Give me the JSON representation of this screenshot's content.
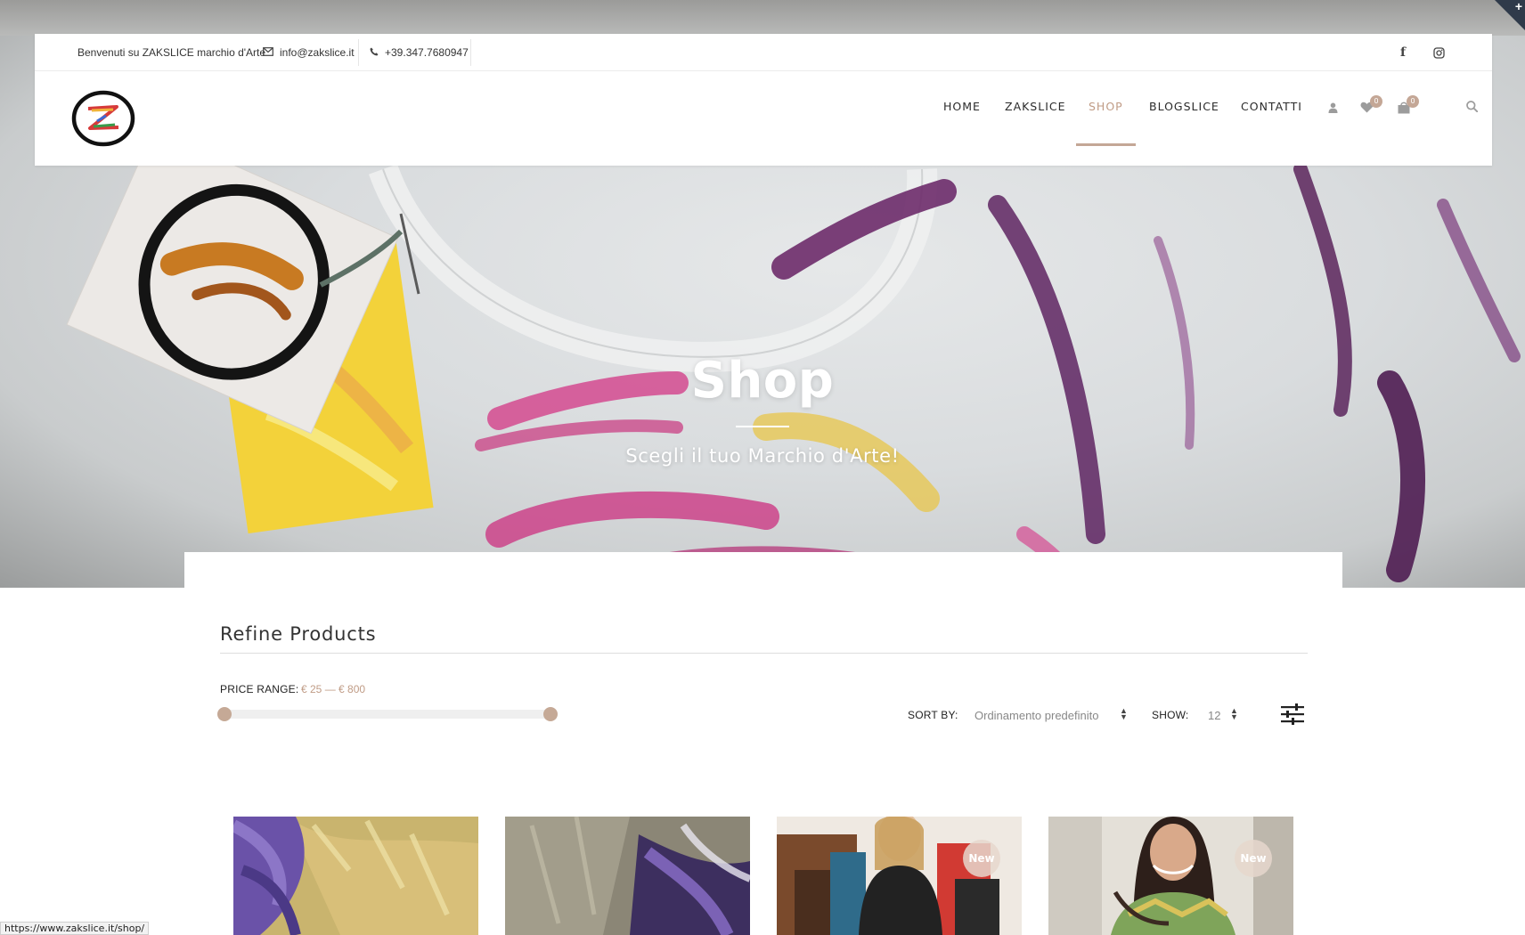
{
  "topbar": {
    "welcome": "Benvenuti su ZAKSLICE marchio d'Arte",
    "email": "info@zakslice.it",
    "phone": "+39.347.7680947",
    "social": [
      "facebook-icon",
      "instagram-icon"
    ]
  },
  "nav": {
    "items": [
      {
        "label": "HOME",
        "active": false
      },
      {
        "label": "ZAKSLICE",
        "active": false
      },
      {
        "label": "SHOP",
        "active": true
      },
      {
        "label": "BLOGSLICE",
        "active": false
      },
      {
        "label": "CONTATTI",
        "active": false
      }
    ],
    "wishlist_count": "0",
    "cart_count": "0",
    "icons": [
      "user-icon",
      "heart-icon",
      "bag-icon",
      "search-icon"
    ]
  },
  "hero": {
    "title": "Shop",
    "subtitle": "Scegli il tuo Marchio d'Arte!"
  },
  "filters": {
    "title": "Refine Products",
    "price_label": "PRICE RANGE:",
    "price_value": "€ 25 — € 800",
    "price_min": 25,
    "price_max": 800,
    "sort_label": "SORT BY:",
    "sort_value": "Ordinamento predefinito",
    "show_label": "SHOW:",
    "show_value": "12"
  },
  "products": [
    {
      "badge": ""
    },
    {
      "badge": ""
    },
    {
      "badge": "New"
    },
    {
      "badge": "New"
    }
  ],
  "status_url": "https://www.zakslice.it/shop/",
  "colors": {
    "accent": "#c4a796",
    "active_nav": "#c09c86",
    "text": "#2b2b2b"
  }
}
